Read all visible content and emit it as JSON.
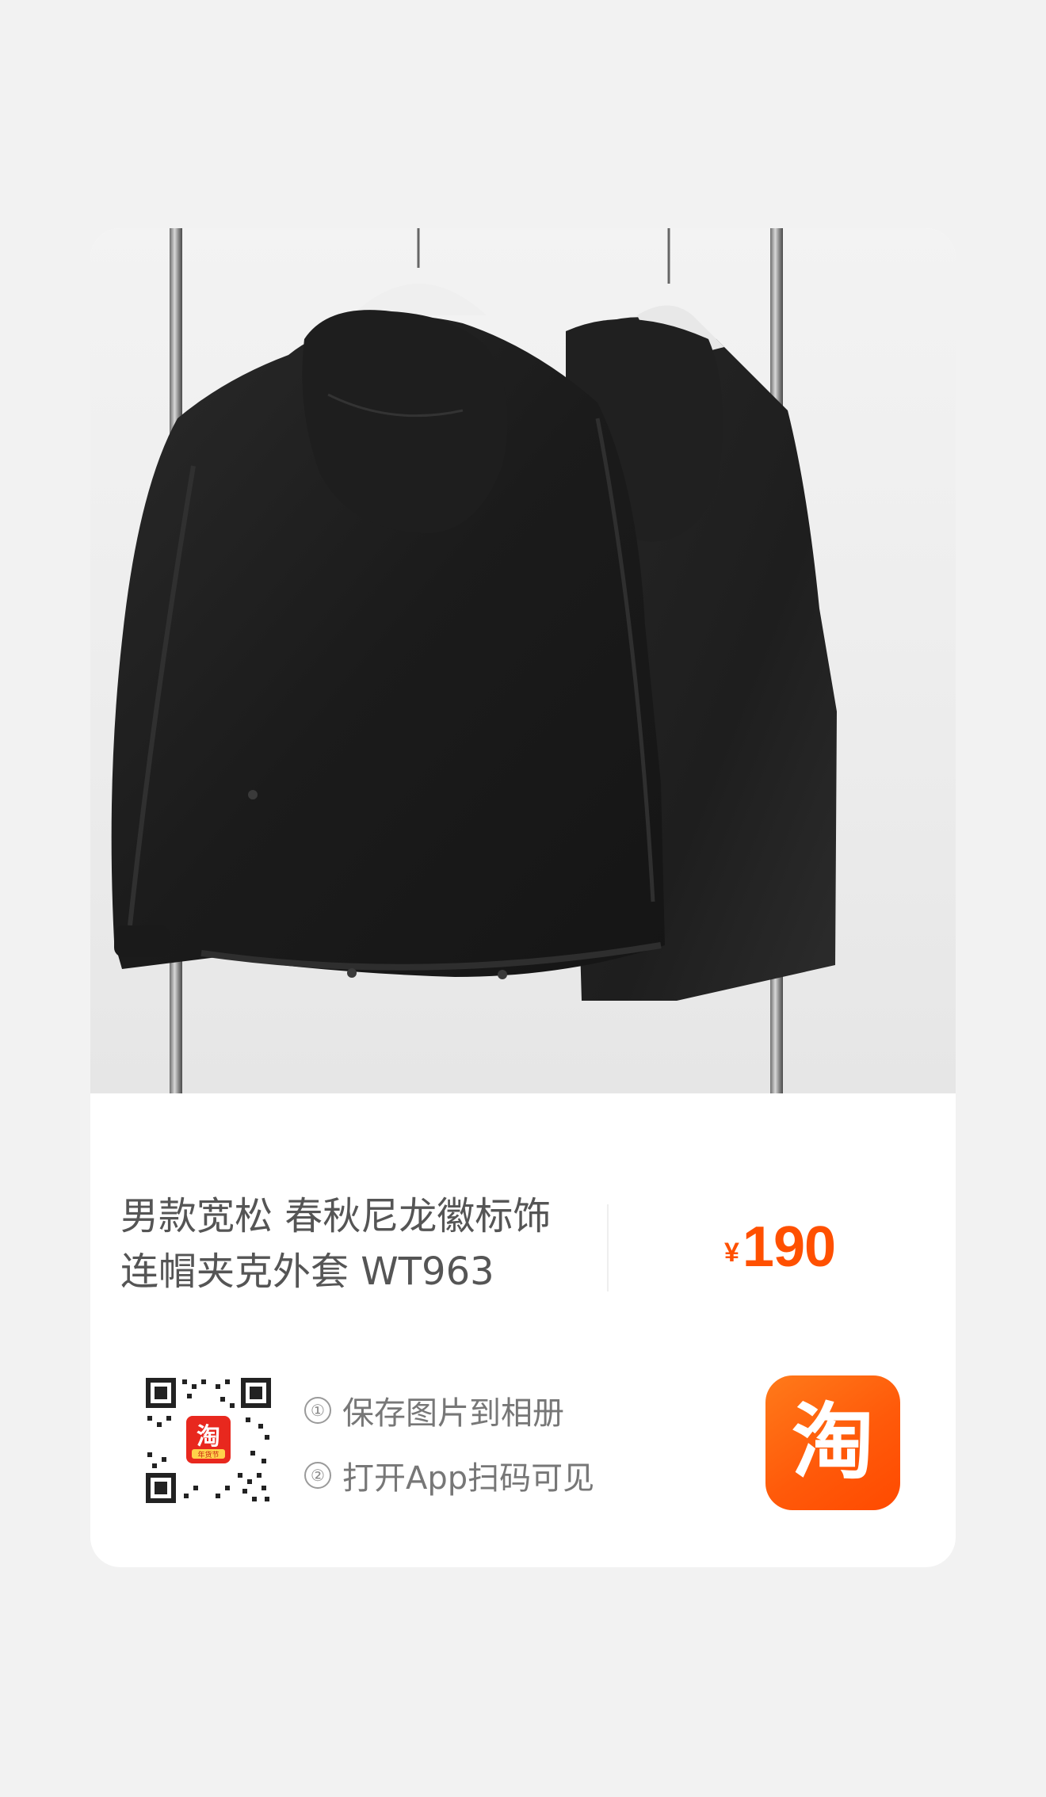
{
  "product": {
    "title_line1": "男款宽松 春秋尼龙徽标饰",
    "title_line2": "连帽夹克外套 WT963",
    "currency": "¥",
    "price": "190",
    "image": "black-hooded-jackets-on-rack"
  },
  "share": {
    "qr_badge_text": "淘",
    "qr_badge_sub": "年货节",
    "step1_num": "①",
    "step1_text": "保存图片到相册",
    "step2_num": "②",
    "step2_text": "打开App扫码可见"
  },
  "app_logo": {
    "glyph": "淘",
    "icon": "taobao-app-icon"
  },
  "colors": {
    "price": "#ff5000",
    "logo_bg": "#ff5a0a",
    "page_bg": "#f2f2f2"
  }
}
